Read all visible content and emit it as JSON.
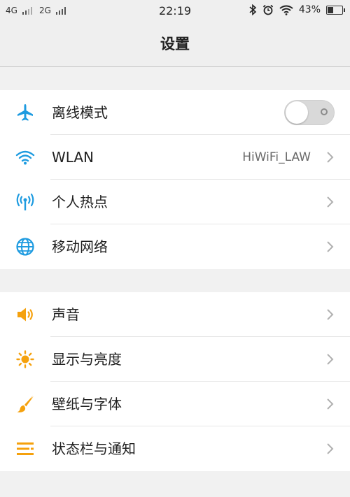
{
  "status_bar": {
    "network1": "4G",
    "network2": "2G",
    "time": "22:19",
    "battery_percent": "43%",
    "icons": [
      "bluetooth-icon",
      "alarm-icon",
      "wifi-icon",
      "battery-icon"
    ]
  },
  "header": {
    "title": "设置"
  },
  "colors": {
    "blue_accent": "#1e9be0",
    "orange_accent": "#f5a10d",
    "chevron": "#b0b0b0"
  },
  "group1": {
    "items": [
      {
        "label": "离线模式",
        "icon": "airplane-icon",
        "control": "toggle",
        "toggle_on": false
      },
      {
        "label": "WLAN",
        "icon": "wifi-icon",
        "value": "HiWiFi_LAW"
      },
      {
        "label": "个人热点",
        "icon": "hotspot-icon"
      },
      {
        "label": "移动网络",
        "icon": "globe-icon"
      }
    ]
  },
  "group2": {
    "items": [
      {
        "label": "声音",
        "icon": "speaker-icon"
      },
      {
        "label": "显示与亮度",
        "icon": "brightness-icon"
      },
      {
        "label": "壁纸与字体",
        "icon": "brush-icon"
      },
      {
        "label": "状态栏与通知",
        "icon": "list-icon"
      }
    ]
  }
}
